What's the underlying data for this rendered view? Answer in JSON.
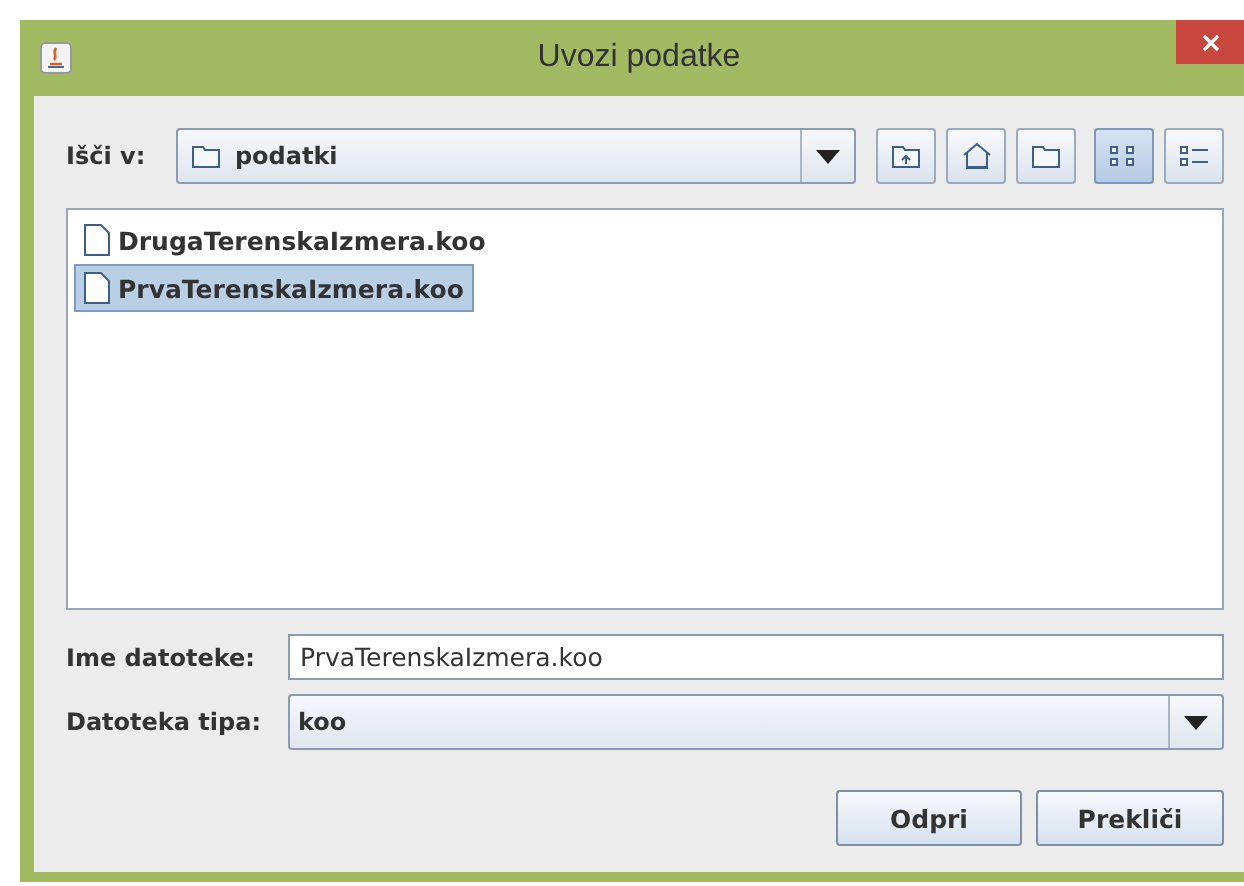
{
  "window": {
    "title": "Uvozi podatke"
  },
  "look_in": {
    "label": "Išči v:",
    "value": "podatki"
  },
  "toolbar": [
    {
      "kind": "up",
      "selected": false
    },
    {
      "kind": "home",
      "selected": false
    },
    {
      "kind": "newfolder",
      "selected": false
    },
    {
      "kind": "list",
      "selected": true
    },
    {
      "kind": "details",
      "selected": false
    }
  ],
  "files": [
    {
      "name": "DrugaTerenskaIzmera.koo",
      "selected": false
    },
    {
      "name": "PrvaTerenskaIzmera.koo",
      "selected": true
    }
  ],
  "file_name": {
    "label": "Ime datoteke:",
    "value": "PrvaTerenskaIzmera.koo"
  },
  "file_type": {
    "label": "Datoteka tipa:",
    "value": "koo"
  },
  "buttons": [
    "Odpri",
    "Prekliči"
  ]
}
